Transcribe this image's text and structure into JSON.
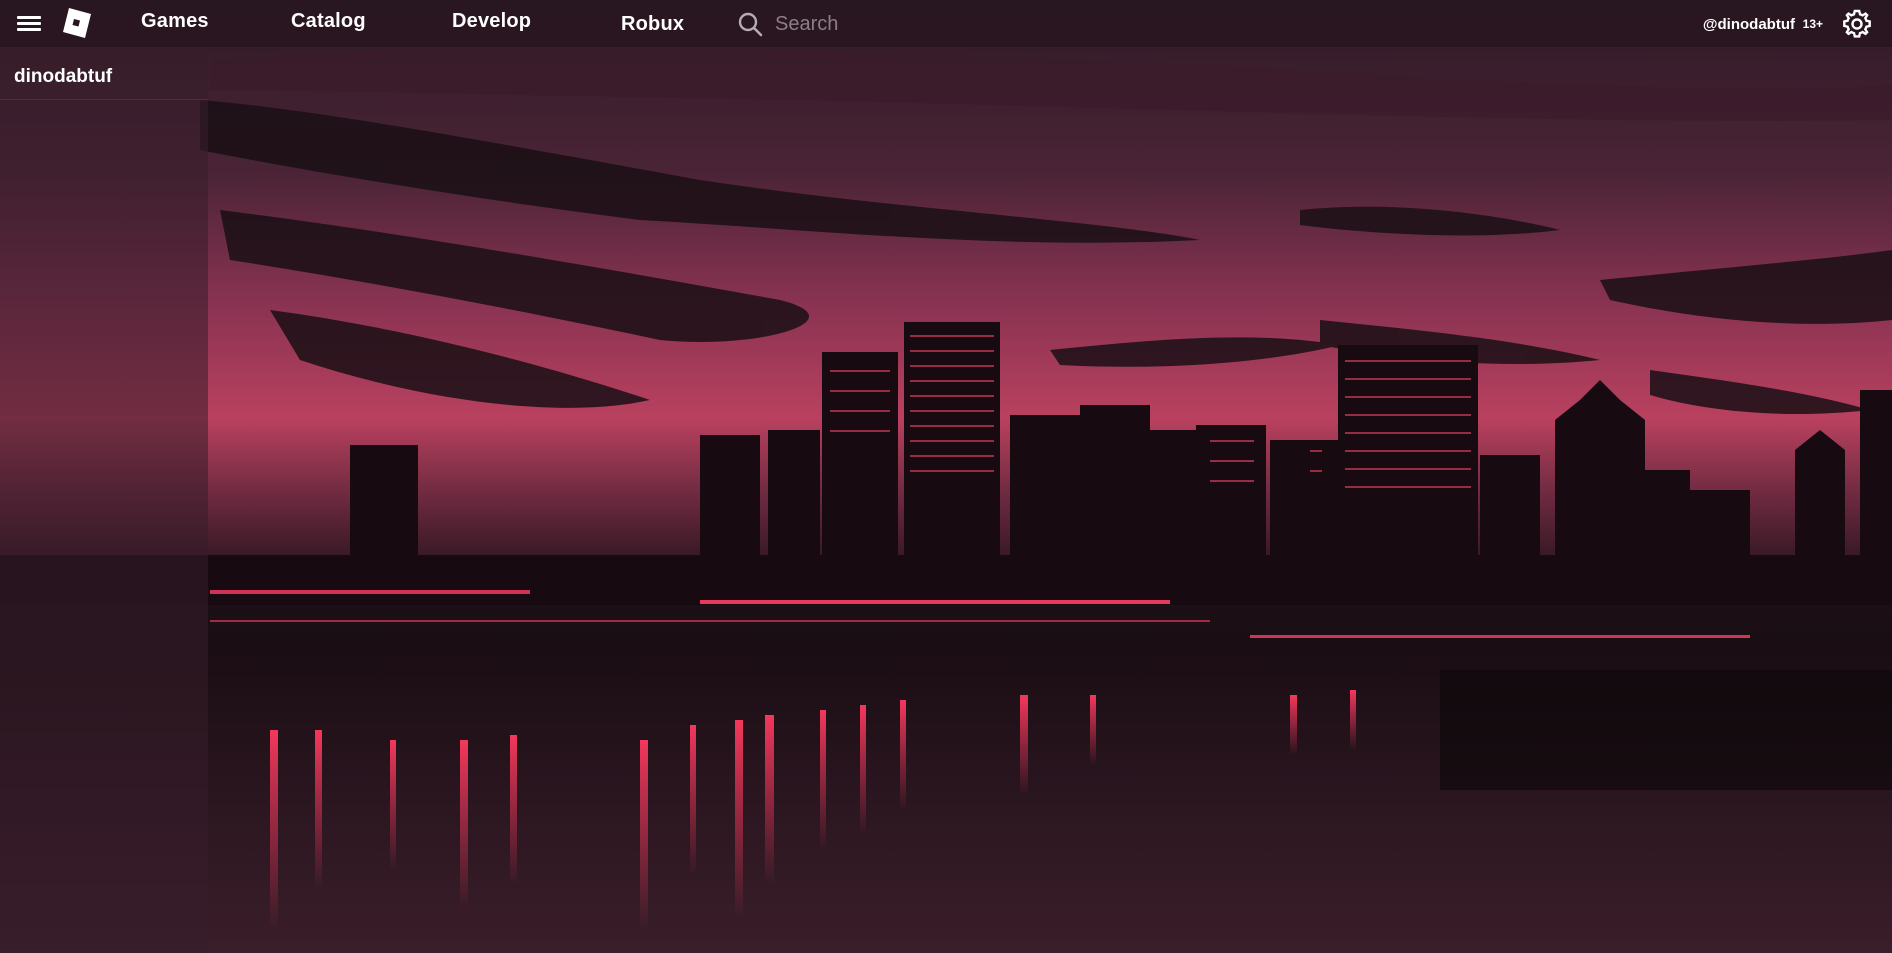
{
  "topbar": {
    "menu_icon": "hamburger-menu-icon",
    "logo_icon": "roblox-logo-icon",
    "nav": [
      {
        "label": "Games"
      },
      {
        "label": "Catalog"
      },
      {
        "label": "Develop"
      },
      {
        "label": "Robux"
      }
    ],
    "search": {
      "icon": "search-icon",
      "placeholder": "Search",
      "value": ""
    },
    "account": {
      "username": "@dinodabtuf",
      "age_badge": "13+"
    },
    "settings_icon": "gear-icon"
  },
  "sidebar": {
    "username": "dinodabtuf"
  },
  "background": {
    "scene": "city-skyline-night-wallpaper",
    "accent": "#e0244c",
    "sky_top": "#3a1e2e",
    "sky_glow": "#b9415f"
  }
}
